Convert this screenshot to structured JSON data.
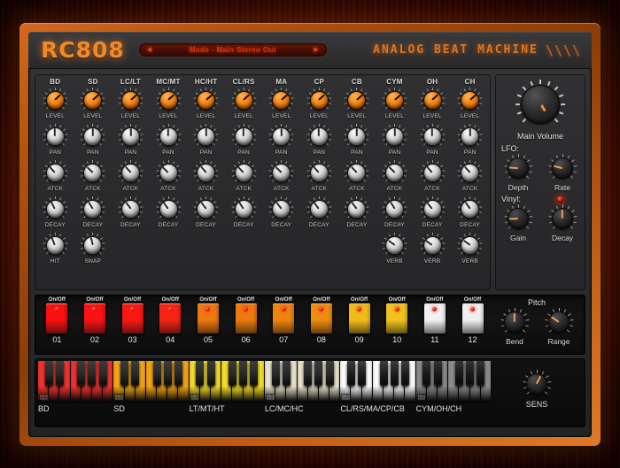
{
  "app": {
    "brand": "RC808",
    "tagline": "ANALOG BEAT MACHINE",
    "tagline_slashes": "\\\\\\\\",
    "mode_label": "Mode - Main Stereo Out",
    "mode_arrow_left": "◀",
    "mode_arrow_right": "▶"
  },
  "colors": {
    "brand_orange": "#f08a28",
    "frame_orange": "#c05e17",
    "panel_gray": "#2e2e30",
    "led_red": "#d41a0a",
    "mode_text_red": "#d4350c"
  },
  "mixer": {
    "row_labels": [
      "LEVEL",
      "PAN",
      "ATCK",
      "DECAY"
    ],
    "extra_row_labels": [
      "HIT",
      "SNAP",
      "VERB"
    ],
    "channels": [
      {
        "name": "BD",
        "level": 68,
        "pan": 50,
        "atck": 35,
        "decay": 40,
        "extra": "HIT",
        "extra_val": 42
      },
      {
        "name": "SD",
        "level": 68,
        "pan": 50,
        "atck": 33,
        "decay": 38,
        "extra": "SNAP",
        "extra_val": 45
      },
      {
        "name": "LC/LT",
        "level": 68,
        "pan": 50,
        "atck": 34,
        "decay": 36,
        "extra": "",
        "extra_val": 0
      },
      {
        "name": "MC/MT",
        "level": 68,
        "pan": 50,
        "atck": 33,
        "decay": 37,
        "extra": "",
        "extra_val": 0
      },
      {
        "name": "HC/HT",
        "level": 68,
        "pan": 50,
        "atck": 35,
        "decay": 36,
        "extra": "",
        "extra_val": 0
      },
      {
        "name": "CL/RS",
        "level": 68,
        "pan": 50,
        "atck": 34,
        "decay": 38,
        "extra": "",
        "extra_val": 0
      },
      {
        "name": "MA",
        "level": 68,
        "pan": 50,
        "atck": 33,
        "decay": 36,
        "extra": "",
        "extra_val": 0
      },
      {
        "name": "CP",
        "level": 68,
        "pan": 50,
        "atck": 35,
        "decay": 37,
        "extra": "",
        "extra_val": 0
      },
      {
        "name": "CB",
        "level": 68,
        "pan": 50,
        "atck": 34,
        "decay": 36,
        "extra": "",
        "extra_val": 0
      },
      {
        "name": "CYM",
        "level": 68,
        "pan": 50,
        "atck": 33,
        "decay": 38,
        "extra": "VERB",
        "extra_val": 30
      },
      {
        "name": "OH",
        "level": 68,
        "pan": 50,
        "atck": 35,
        "decay": 36,
        "extra": "VERB",
        "extra_val": 30
      },
      {
        "name": "CH",
        "level": 68,
        "pan": 50,
        "atck": 34,
        "decay": 37,
        "extra": "VERB",
        "extra_val": 30
      }
    ]
  },
  "master": {
    "main_volume_label": "Main Volume",
    "main_volume_value": 72,
    "lfo_heading": "LFO:",
    "lfo_depth_label": "Depth",
    "lfo_depth_value": 18,
    "lfo_rate_label": "Rate",
    "lfo_rate_value": 22,
    "vinyl_heading": "Vinyl:",
    "vinyl_led_on": true,
    "vinyl_gain_label": "Gain",
    "vinyl_gain_value": 16,
    "vinyl_decay_label": "Decay",
    "vinyl_decay_value": 50
  },
  "pads": {
    "onoff_label": "On/Off",
    "items": [
      {
        "num": "01",
        "color": "#fb1010"
      },
      {
        "num": "02",
        "color": "#fb1212"
      },
      {
        "num": "03",
        "color": "#fa1814"
      },
      {
        "num": "04",
        "color": "#f92416"
      },
      {
        "num": "05",
        "color": "#f07810"
      },
      {
        "num": "06",
        "color": "#ee7a0e"
      },
      {
        "num": "07",
        "color": "#f0840f"
      },
      {
        "num": "08",
        "color": "#f08c10"
      },
      {
        "num": "09",
        "color": "#f2bc18"
      },
      {
        "num": "10",
        "color": "#f2c31c"
      },
      {
        "num": "11",
        "color": "#f2f2f2"
      },
      {
        "num": "12",
        "color": "#f0f0f0"
      }
    ]
  },
  "pitch": {
    "title": "Pitch",
    "bend_label": "Bend",
    "bend_value": 50,
    "range_label": "Range",
    "range_value": 30
  },
  "keyboard": {
    "sens_label": "SENS",
    "sens_value": 60,
    "octaves": [
      {
        "tag": "C2",
        "white": "#f4352e",
        "black": "#2a2a2a"
      },
      {
        "tag": "C3",
        "white": "#f5a716",
        "black": "#2a2a2a"
      },
      {
        "tag": "C4",
        "white": "#f7e02a",
        "black": "#2a2a2a"
      },
      {
        "tag": "C5",
        "white": "#ece6cf",
        "black": "#2a2a2a"
      },
      {
        "tag": "C6",
        "white": "#ffffff",
        "black": "#1e1e1e"
      },
      {
        "tag": "C7",
        "white": "#8e8e8e",
        "black": "#1a1a1a"
      }
    ],
    "zones": [
      {
        "label": "BD",
        "start": 0
      },
      {
        "label": "SD",
        "start": 1
      },
      {
        "label": "LT/MT/HT",
        "start": 2
      },
      {
        "label": "LC/MC/HC",
        "start": 3
      },
      {
        "label": "CL/RS/MA/CP/CB",
        "start": 4
      },
      {
        "label": "CYM/OH/CH",
        "start": 5
      }
    ]
  }
}
